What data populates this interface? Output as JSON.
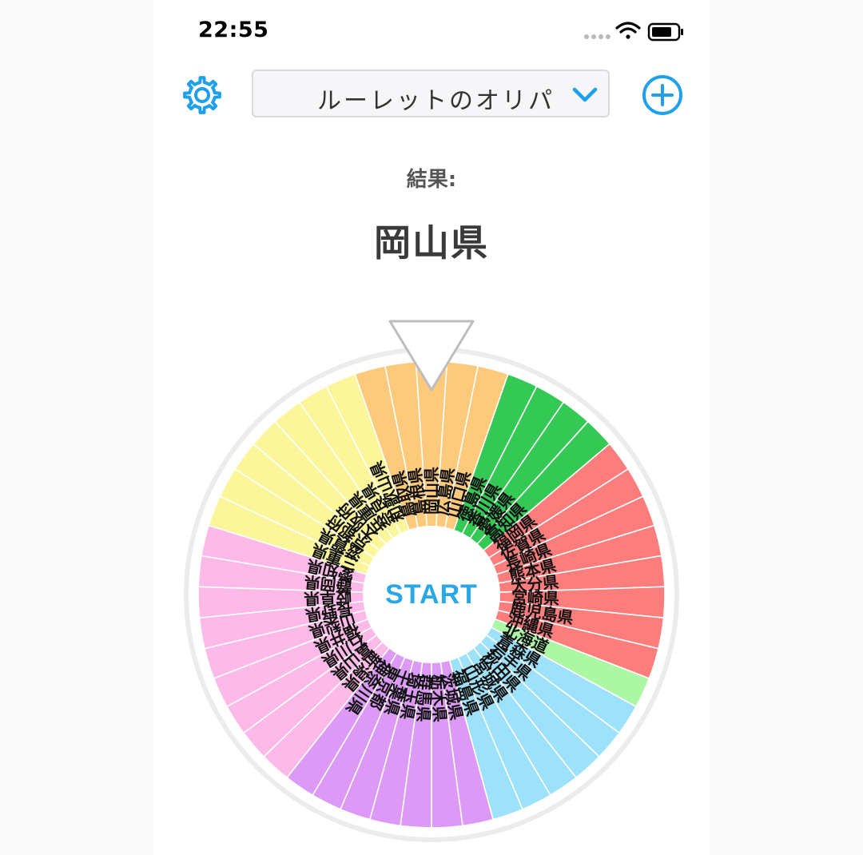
{
  "status_bar": {
    "time": "22:55"
  },
  "header": {
    "settings_icon": "gear-icon",
    "selector_label": "ルーレットのオリパ",
    "selector_icon": "chevron-down-icon",
    "add_icon": "plus-circle-icon"
  },
  "result": {
    "label": "結果:",
    "value": "岡山県"
  },
  "wheel": {
    "start_label": "START",
    "pointer_icon": "triangle-pointer-icon",
    "colors": {
      "hokkaido": "#acf7a4",
      "tohoku": "#9de1fa",
      "kanto": "#dd99f6",
      "chubu": "#fdb9e7",
      "kinki": "#fcf69a",
      "chugoku": "#fdc97b",
      "shikoku": "#34c854",
      "kyushu": "#fd7c7c"
    },
    "segments": [
      {
        "label": "北海道",
        "region": "hokkaido"
      },
      {
        "label": "青森県",
        "region": "tohoku"
      },
      {
        "label": "岩手県",
        "region": "tohoku"
      },
      {
        "label": "秋田県",
        "region": "tohoku"
      },
      {
        "label": "宮城県",
        "region": "tohoku"
      },
      {
        "label": "山形県",
        "region": "tohoku"
      },
      {
        "label": "福島県",
        "region": "tohoku"
      },
      {
        "label": "茨城県",
        "region": "kanto"
      },
      {
        "label": "栃木県",
        "region": "kanto"
      },
      {
        "label": "群馬県",
        "region": "kanto"
      },
      {
        "label": "埼玉県",
        "region": "kanto"
      },
      {
        "label": "千葉県",
        "region": "kanto"
      },
      {
        "label": "東京都",
        "region": "kanto"
      },
      {
        "label": "神奈川県",
        "region": "kanto"
      },
      {
        "label": "新潟県",
        "region": "chubu"
      },
      {
        "label": "富山県",
        "region": "chubu"
      },
      {
        "label": "石川県",
        "region": "chubu"
      },
      {
        "label": "福井県",
        "region": "chubu"
      },
      {
        "label": "山梨県",
        "region": "chubu"
      },
      {
        "label": "長野県",
        "region": "chubu"
      },
      {
        "label": "岐阜県",
        "region": "chubu"
      },
      {
        "label": "静岡県",
        "region": "chubu"
      },
      {
        "label": "愛知県",
        "region": "chubu"
      },
      {
        "label": "三重県",
        "region": "kinki"
      },
      {
        "label": "滋賀県",
        "region": "kinki"
      },
      {
        "label": "京都府",
        "region": "kinki"
      },
      {
        "label": "大阪府",
        "region": "kinki"
      },
      {
        "label": "兵庫県",
        "region": "kinki"
      },
      {
        "label": "奈良県",
        "region": "kinki"
      },
      {
        "label": "和歌山県",
        "region": "kinki"
      },
      {
        "label": "鳥取県",
        "region": "chugoku"
      },
      {
        "label": "島根県",
        "region": "chugoku"
      },
      {
        "label": "岡山県",
        "region": "chugoku"
      },
      {
        "label": "広島県",
        "region": "chugoku"
      },
      {
        "label": "山口県",
        "region": "chugoku"
      },
      {
        "label": "徳島県",
        "region": "shikoku"
      },
      {
        "label": "香川県",
        "region": "shikoku"
      },
      {
        "label": "愛媛県",
        "region": "shikoku"
      },
      {
        "label": "高知県",
        "region": "shikoku"
      },
      {
        "label": "福岡県",
        "region": "kyushu"
      },
      {
        "label": "佐賀県",
        "region": "kyushu"
      },
      {
        "label": "長崎県",
        "region": "kyushu"
      },
      {
        "label": "熊本県",
        "region": "kyushu"
      },
      {
        "label": "大分県",
        "region": "kyushu"
      },
      {
        "label": "宮崎県",
        "region": "kyushu"
      },
      {
        "label": "鹿児島県",
        "region": "kyushu"
      },
      {
        "label": "沖縄県",
        "region": "kyushu"
      }
    ]
  }
}
